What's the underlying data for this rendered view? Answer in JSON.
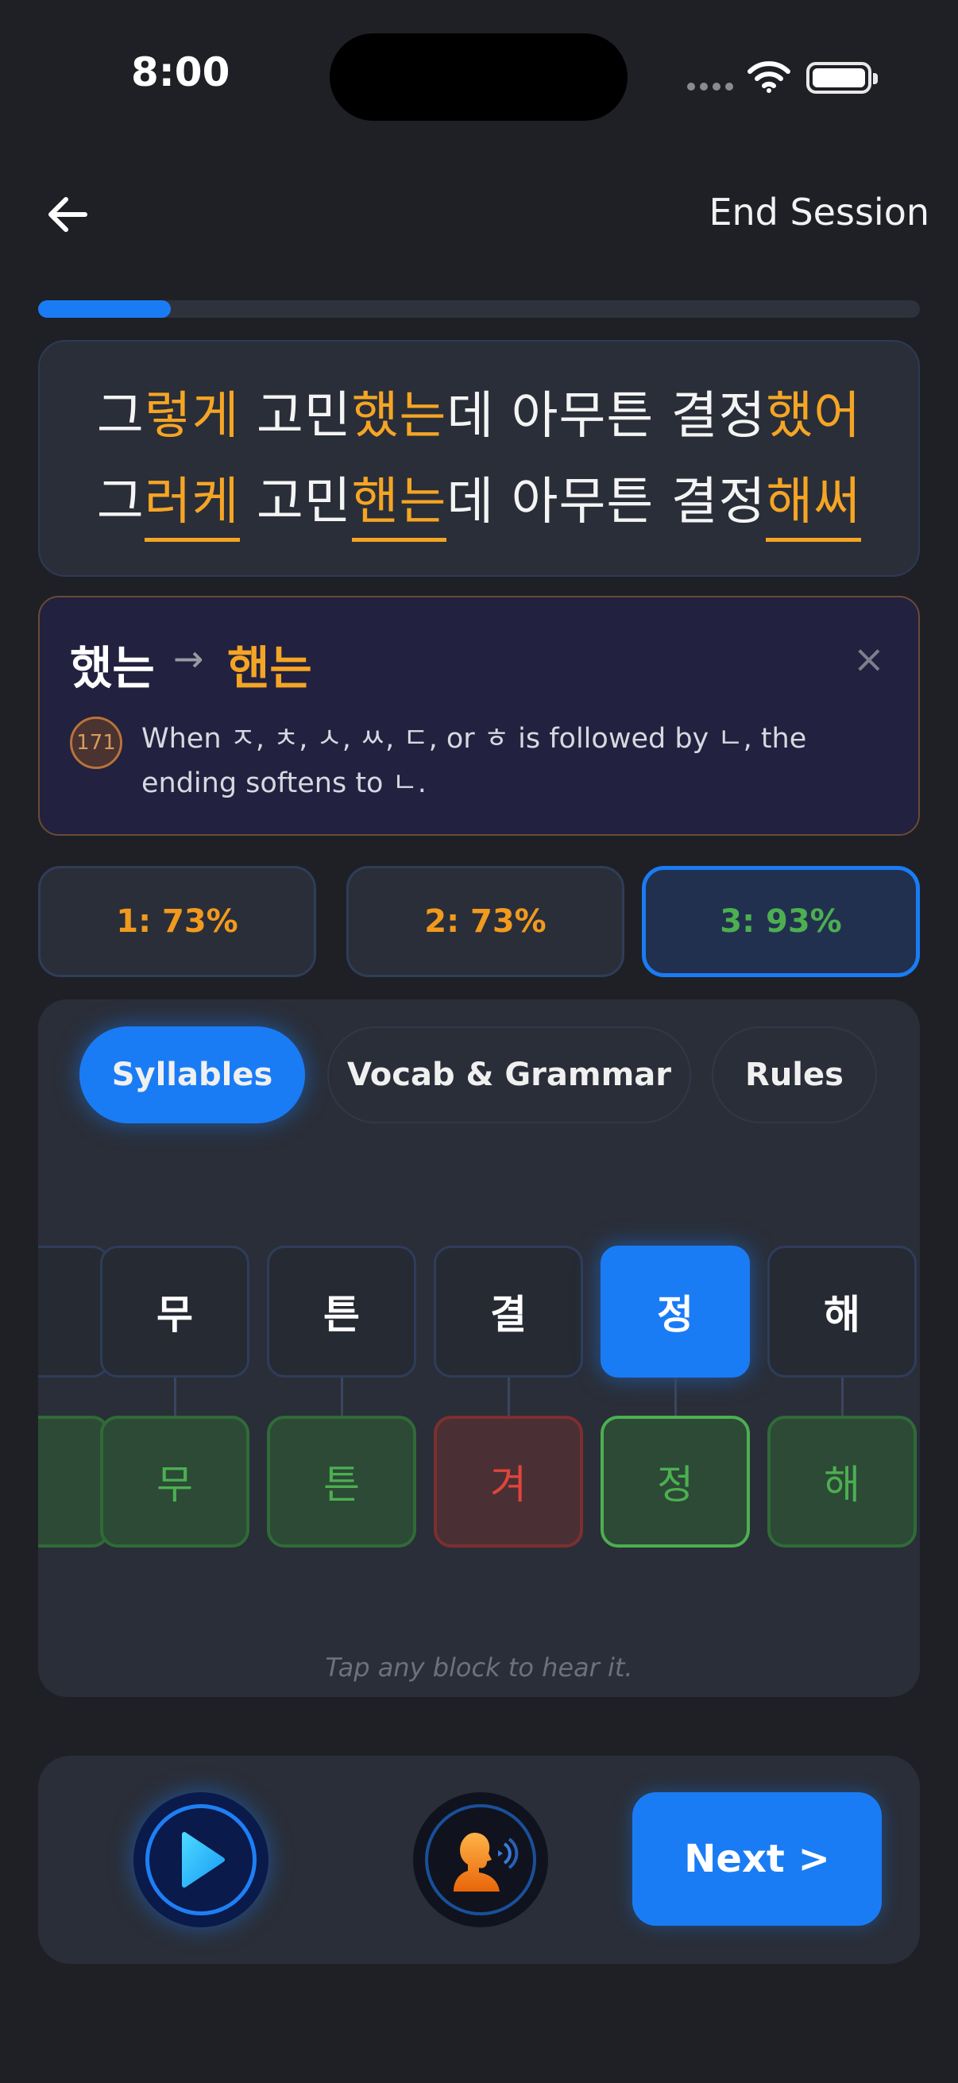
{
  "status_bar": {
    "time": "8:00"
  },
  "header": {
    "end_session_label": "End Session",
    "back_icon": "arrow-left-icon"
  },
  "progress": {
    "fraction": 0.15,
    "color": "#1a7cf5"
  },
  "sentence": {
    "target": [
      {
        "text": "그",
        "style": "plain"
      },
      {
        "text": "렇게",
        "style": "hl"
      },
      {
        "text": " 고민",
        "style": "plain"
      },
      {
        "text": "했는",
        "style": "hl"
      },
      {
        "text": "데 아무튼 결정",
        "style": "plain"
      },
      {
        "text": "했어",
        "style": "hl"
      }
    ],
    "spoken": [
      {
        "text": "그",
        "style": "plain"
      },
      {
        "text": "러케",
        "style": "ul"
      },
      {
        "text": " 고민",
        "style": "plain"
      },
      {
        "text": "핸는",
        "style": "ul"
      },
      {
        "text": "데 아무튼 결정",
        "style": "plain"
      },
      {
        "text": "해써",
        "style": "ul"
      }
    ]
  },
  "rule": {
    "from": "했는",
    "arrow": "→",
    "to": "핸는",
    "close": "×",
    "badge": "171",
    "description": "When ㅈ, ㅊ, ㅅ, ㅆ, ㄷ, or ㅎ is followed by ㄴ, the ending softens to ㄴ."
  },
  "attempts": [
    {
      "label": "1: 73%",
      "tone": "orange",
      "selected": false
    },
    {
      "label": "2: 73%",
      "tone": "orange",
      "selected": false
    },
    {
      "label": "3: 93%",
      "tone": "green",
      "selected": true
    }
  ],
  "tabs": [
    {
      "label": "Syllables",
      "active": true
    },
    {
      "label": "Vocab & Grammar",
      "active": false
    },
    {
      "label": "Rules",
      "active": false
    }
  ],
  "syllables": {
    "expected": [
      "",
      "무",
      "튼",
      "결",
      "정",
      "해"
    ],
    "heard": [
      "",
      "무",
      "튼",
      "겨",
      "정",
      "해"
    ],
    "status": [
      "ok",
      "ok",
      "ok",
      "bad",
      "ok",
      "ok"
    ],
    "selected_index": 4
  },
  "hint": "Tap any block to hear it.",
  "controls": {
    "play_icon": "play-icon",
    "speak_icon": "speaker-person-icon",
    "next_label": "Next >"
  }
}
